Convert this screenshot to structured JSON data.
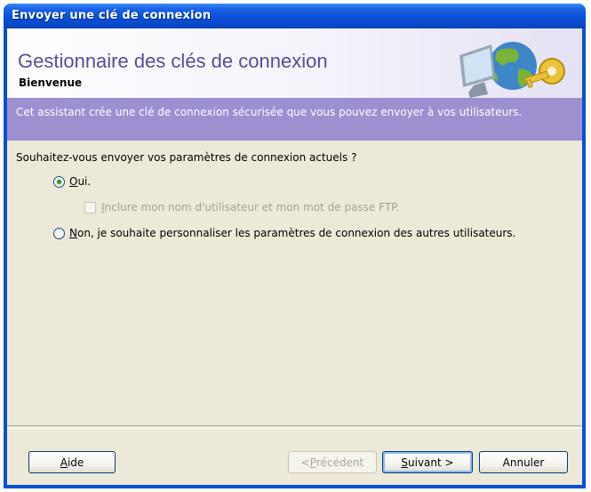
{
  "window": {
    "title": "Envoyer une clé de connexion"
  },
  "header": {
    "title": "Gestionnaire des clés de connexion",
    "subtitle": "Bienvenue"
  },
  "banner": {
    "text": "Cet assistant crée une clé de connexion sécurisée que vous pouvez envoyer à vos utilisateurs."
  },
  "form": {
    "question": "Souhaitez-vous envoyer vos paramètres de connexion actuels ?",
    "option_yes": {
      "mnemonic": "O",
      "rest": "ui.",
      "selected": true
    },
    "include_credentials": {
      "mnemonic": "I",
      "rest": "nclure mon nom d'utilisateur et mon mot de passe FTP.",
      "checked": false,
      "enabled": false
    },
    "option_no": {
      "mnemonic": "N",
      "rest": "on, je souhaite personnaliser les paramètres de connexion des autres utilisateurs.",
      "selected": false
    }
  },
  "buttons": {
    "help": {
      "mnemonic": "A",
      "rest": "ide"
    },
    "previous": {
      "prefix": "< ",
      "mnemonic": "P",
      "rest": "récédent",
      "enabled": false
    },
    "next": {
      "mnemonic": "S",
      "rest": "uivant >"
    },
    "cancel": {
      "label": "Annuler"
    }
  },
  "icons": [
    "monitor-globe-key-icon"
  ]
}
